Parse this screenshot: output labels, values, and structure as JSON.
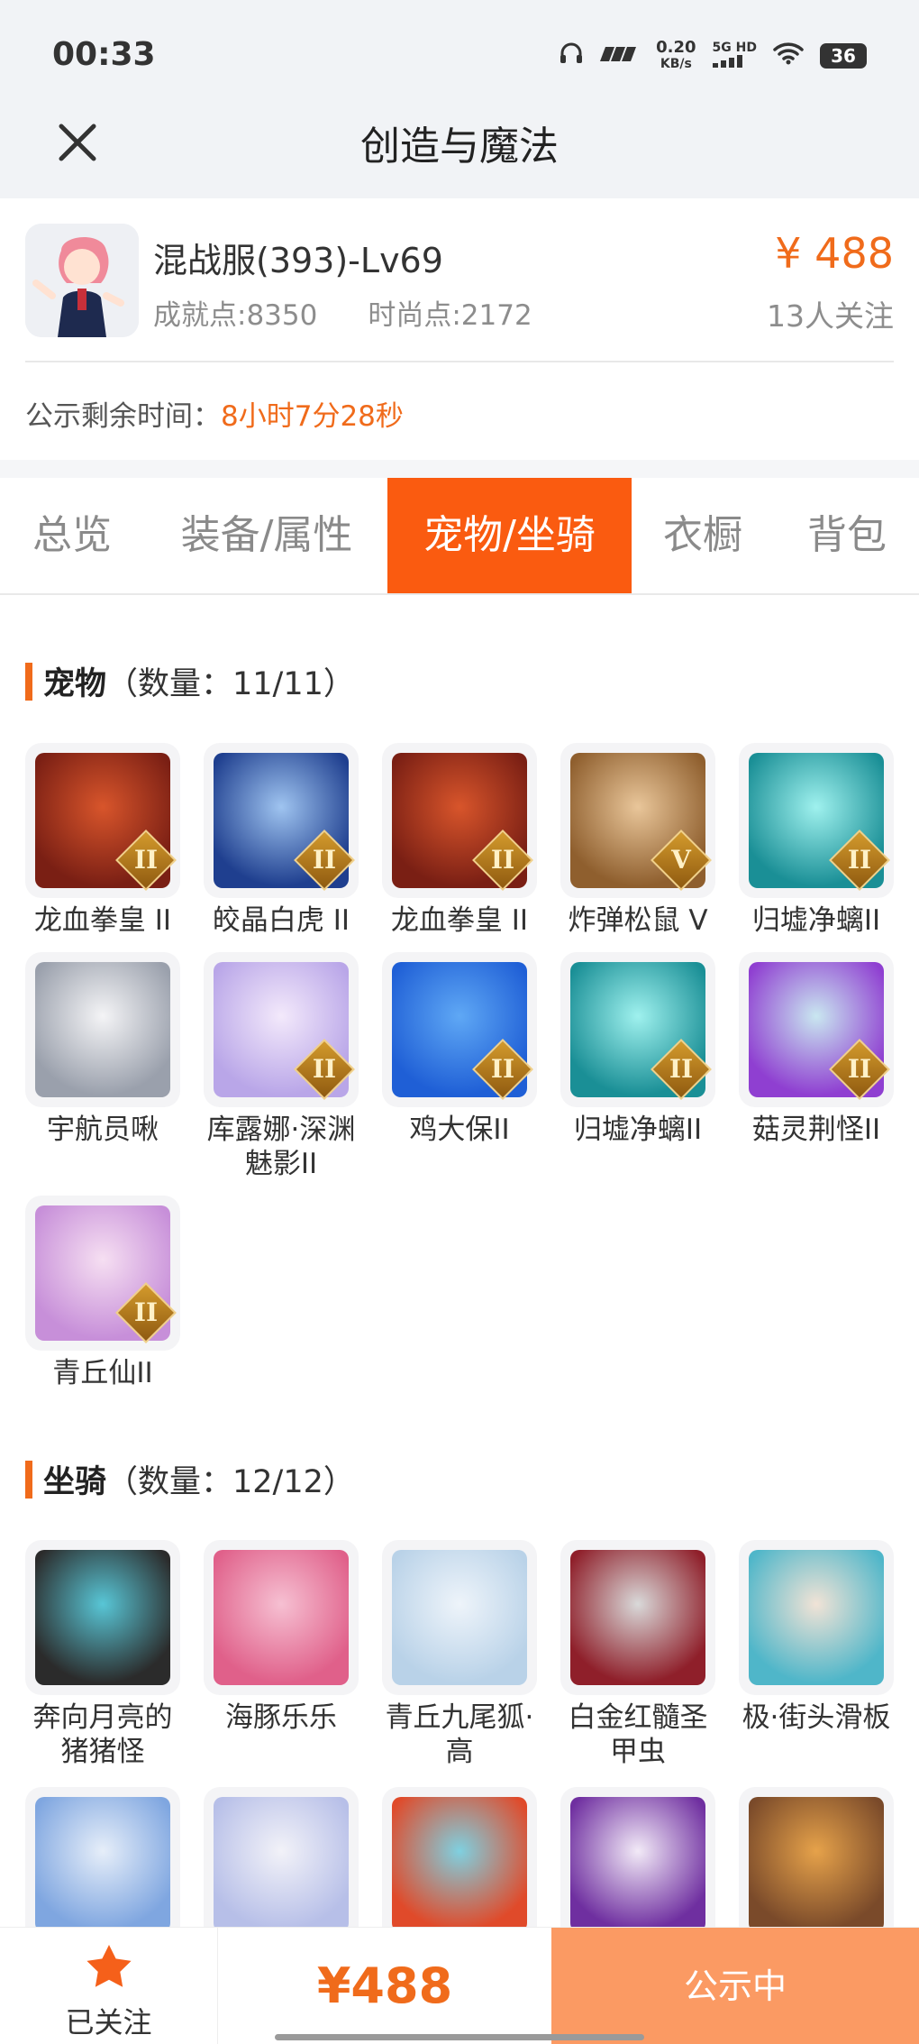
{
  "status_bar": {
    "time": "00:33",
    "net_speed_value": "0.20",
    "net_speed_unit": "KB/s",
    "network": "5G HD",
    "battery": "36"
  },
  "header": {
    "title": "创造与魔法"
  },
  "account": {
    "server_level": "混战服(393)-Lv69",
    "achievement": "成就点:8350",
    "fashion": "时尚点:2172",
    "price": "¥ 488",
    "followers": "13人关注",
    "notice_label": "公示剩余时间：",
    "notice_countdown": "8小时7分28秒"
  },
  "tabs": [
    {
      "label": "总览"
    },
    {
      "label": "装备/属性"
    },
    {
      "label": "宠物/坐骑",
      "active": true
    },
    {
      "label": "衣橱"
    },
    {
      "label": "背包"
    }
  ],
  "pets": {
    "title": "宠物",
    "count": "（数量：11/11）",
    "items": [
      {
        "name": "龙血拳皇 II",
        "grade": "II",
        "colors": [
          "#7a1f14",
          "#d8552b"
        ]
      },
      {
        "name": "皎晶白虎 II",
        "grade": "II",
        "colors": [
          "#1f3f8f",
          "#9fc4f0"
        ]
      },
      {
        "name": "龙血拳皇 II",
        "grade": "II",
        "colors": [
          "#7a1f14",
          "#d8552b"
        ]
      },
      {
        "name": "炸弹松鼠 V",
        "grade": "V",
        "colors": [
          "#8f5f2e",
          "#e9c69a"
        ]
      },
      {
        "name": "归墟净螭II",
        "grade": "II",
        "colors": [
          "#1a8f96",
          "#9ff1ee"
        ]
      },
      {
        "name": "宇航员啾",
        "grade": "",
        "colors": [
          "#9aa0ac",
          "#f4f4f6"
        ]
      },
      {
        "name": "库露娜·深渊魅影II",
        "grade": "II",
        "colors": [
          "#b9a6e8",
          "#f3e9fb"
        ]
      },
      {
        "name": "鸡大保II",
        "grade": "II",
        "colors": [
          "#1f5fd6",
          "#5fa8f5"
        ]
      },
      {
        "name": "归墟净螭II",
        "grade": "II",
        "colors": [
          "#1a8f96",
          "#9ff1ee"
        ]
      },
      {
        "name": "菇灵荆怪II",
        "grade": "II",
        "colors": [
          "#8f3fd1",
          "#c9e7f0"
        ]
      },
      {
        "name": "青丘仙II",
        "grade": "II",
        "colors": [
          "#c78fd9",
          "#f6dff2"
        ]
      }
    ]
  },
  "mounts": {
    "title": "坐骑",
    "count": "（数量：12/12）",
    "items": [
      {
        "name": "奔向月亮的猪猪怪",
        "colors": [
          "#2b2b2b",
          "#58c6d6"
        ]
      },
      {
        "name": "海豚乐乐",
        "colors": [
          "#e0608a",
          "#f6c0d2"
        ]
      },
      {
        "name": "青丘九尾狐·高",
        "colors": [
          "#b9d2e8",
          "#eef4fa"
        ]
      },
      {
        "name": "白金红髓圣甲虫",
        "colors": [
          "#8f1f2a",
          "#d9d9d9"
        ]
      },
      {
        "name": "极·街头滑板",
        "colors": [
          "#4fb6c9",
          "#f1e3d6"
        ]
      },
      {
        "name": "",
        "colors": [
          "#7fa6e0",
          "#e6eef9"
        ]
      },
      {
        "name": "",
        "colors": [
          "#b7bfe8",
          "#f2f2f8"
        ]
      },
      {
        "name": "",
        "colors": [
          "#e04a2a",
          "#7fd0e0"
        ]
      },
      {
        "name": "",
        "colors": [
          "#6f2fa0",
          "#f2eaf7"
        ]
      },
      {
        "name": "",
        "colors": [
          "#7a4a2a",
          "#e6a24a"
        ]
      }
    ]
  },
  "bottom": {
    "follow_label": "已关注",
    "price": "¥488",
    "status_label": "公示中"
  },
  "colors": {
    "accent": "#f06b1b",
    "tab_active": "#fa5b10",
    "status_button": "#fb9a63"
  }
}
